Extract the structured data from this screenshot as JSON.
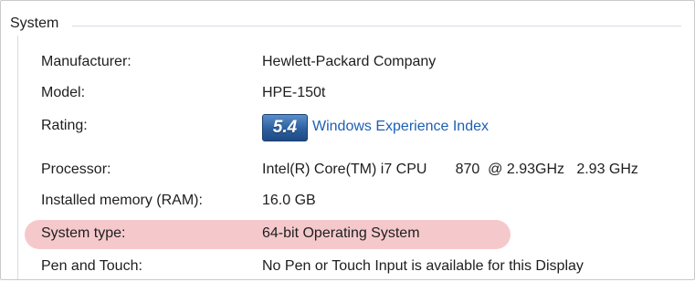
{
  "group": {
    "title": "System"
  },
  "colors": {
    "highlight": "#f5c9cc",
    "link": "#1d5fb5",
    "badge": "#2c5f9e"
  },
  "rows": {
    "manufacturer": {
      "label": "Manufacturer:",
      "value": "Hewlett-Packard Company"
    },
    "model": {
      "label": "Model:",
      "value": "HPE-150t"
    },
    "rating": {
      "label": "Rating:",
      "score": "5.4",
      "link_text": "Windows Experience Index"
    },
    "processor": {
      "label": "Processor:",
      "value": "Intel(R) Core(TM) i7 CPU       870  @ 2.93GHz   2.93 GHz"
    },
    "memory": {
      "label": "Installed memory (RAM):",
      "value": "16.0 GB"
    },
    "system_type": {
      "label": "System type:",
      "value": "64-bit Operating System"
    },
    "pen_touch": {
      "label": "Pen and Touch:",
      "value": "No Pen or Touch Input is available for this Display"
    }
  }
}
